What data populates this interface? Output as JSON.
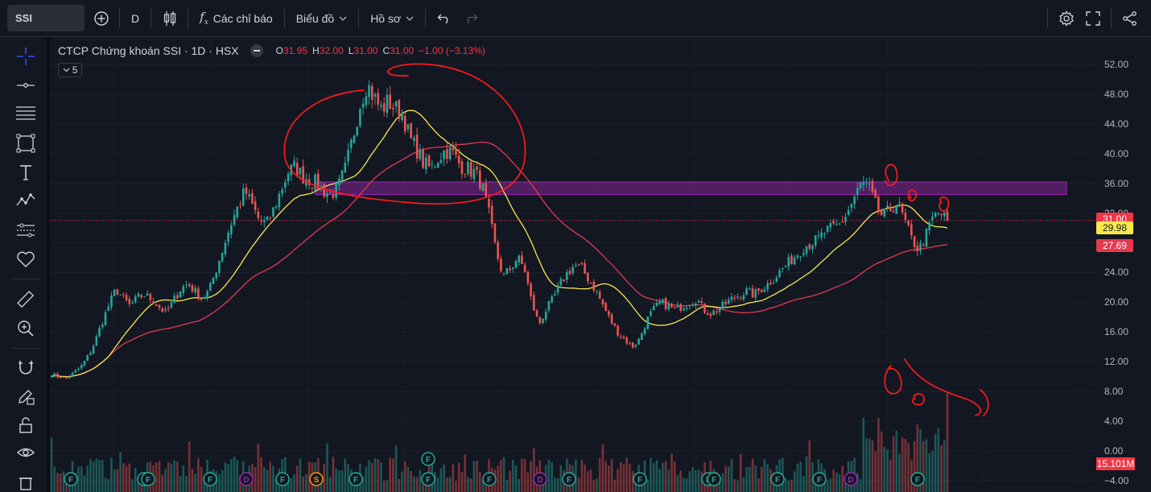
{
  "topbar": {
    "symbol": "SSI",
    "interval": "D",
    "indicators_label": "Các chỉ báo",
    "chart_label": "Biểu đồ",
    "profile_label": "Hồ sơ"
  },
  "legend": {
    "title": "CTCP Chứng khoán SSI · 1D · HSX",
    "o_key": "O",
    "o_val": "31.95",
    "h_key": "H",
    "h_val": "32.00",
    "l_key": "L",
    "l_val": "31.00",
    "c_key": "C",
    "c_val": "31.00",
    "change": "−1.00 (−3.13%)",
    "collapsed_count": "5"
  },
  "price_scale": {
    "ticks": [
      "52.00",
      "48.00",
      "44.00",
      "40.00",
      "36.00",
      "32.00",
      "28.00",
      "24.00",
      "20.00",
      "16.00",
      "12.00",
      "8.00",
      "4.00",
      "0.00",
      "−4.00"
    ],
    "last_price": "31.00",
    "ma_yellow": "29.98",
    "ma_red": "27.69",
    "volume": "15.101M"
  },
  "colors": {
    "up": "#26a69a",
    "down": "#ef5350",
    "ma_yellow": "#f7e94b",
    "ma_red": "#e53950",
    "zone": "#9c27b0",
    "annotation": "#ff1a1a"
  },
  "events": [
    {
      "type": "F"
    },
    {
      "type": "F"
    },
    {
      "type": "F"
    },
    {
      "type": "F"
    },
    {
      "type": "D"
    },
    {
      "type": "F"
    },
    {
      "type": "S"
    },
    {
      "type": "F"
    },
    {
      "type": "F"
    },
    {
      "type": "F"
    },
    {
      "type": "F"
    },
    {
      "type": "D"
    },
    {
      "type": "F"
    },
    {
      "type": "F"
    },
    {
      "type": "F"
    },
    {
      "type": "F"
    },
    {
      "type": "F"
    },
    {
      "type": "F"
    },
    {
      "type": "D"
    },
    {
      "type": "F"
    },
    {
      "type": "F"
    }
  ],
  "chart_data": {
    "type": "candlestick",
    "title": "CTCP Chứng khoán SSI · 1D · HSX",
    "y_range": [
      -4,
      54
    ],
    "close_series": [
      10.3,
      10.0,
      9.8,
      10.4,
      11.2,
      12.6,
      14.5,
      17.2,
      19.6,
      21.8,
      20.5,
      19.5,
      20.6,
      21.0,
      20.4,
      19.4,
      18.5,
      20.2,
      21.8,
      22.5,
      21.5,
      20.5,
      21.6,
      24.5,
      27.5,
      30.5,
      32.8,
      35.0,
      33.0,
      31.0,
      30.5,
      32.5,
      35.0,
      37.5,
      38.3,
      37.0,
      36.5,
      36.0,
      35.0,
      34.5,
      35.5,
      38.0,
      42.0,
      46.5,
      49.5,
      47.5,
      46.0,
      47.0,
      46.0,
      45.5,
      42.0,
      40.5,
      38.5,
      38.0,
      39.5,
      40.5,
      40.0,
      38.5,
      38.0,
      37.5,
      36.0,
      32.0,
      27.0,
      23.5,
      24.5,
      26.0,
      24.5,
      20.0,
      17.0,
      19.0,
      20.5,
      22.5,
      24.0,
      25.0,
      24.5,
      23.0,
      21.5,
      19.5,
      17.5,
      16.0,
      15.0,
      14.0,
      15.0,
      17.5,
      19.0,
      20.0,
      19.5,
      19.0,
      19.5,
      20.0,
      20.5,
      19.0,
      18.5,
      19.0,
      19.8,
      20.5,
      21.0,
      21.5,
      21.0,
      21.8,
      22.5,
      23.5,
      24.5,
      25.5,
      26.5,
      27.5,
      28.0,
      28.5,
      29.5,
      30.0,
      30.5,
      32.0,
      34.0,
      36.0,
      35.5,
      33.0,
      31.5,
      32.5,
      33.5,
      31.0,
      28.5,
      27.0,
      29.0,
      31.5,
      32.0,
      31.0
    ],
    "ma_short": {
      "name": "",
      "last": 29.98
    },
    "ma_long": {
      "name": "",
      "last": 27.69
    },
    "resistance_zone": [
      34.5,
      36.2
    ],
    "volume_last": "15.101M"
  }
}
